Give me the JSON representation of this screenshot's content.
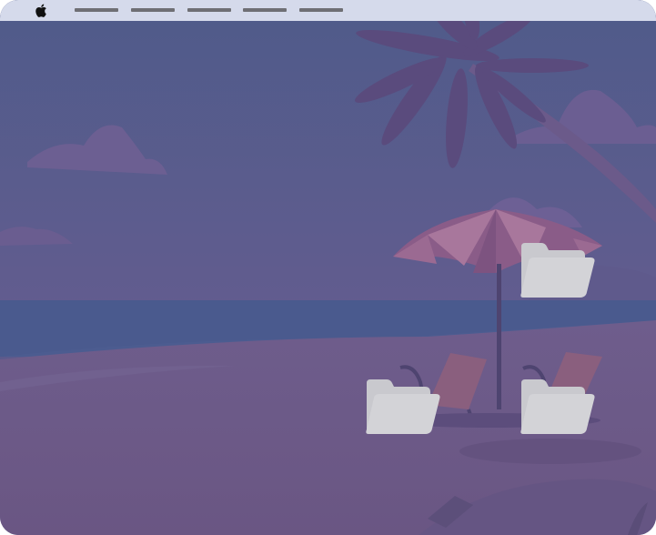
{
  "menubar": {
    "menu_items": [
      {
        "label": ""
      },
      {
        "label": ""
      },
      {
        "label": ""
      },
      {
        "label": ""
      },
      {
        "label": ""
      }
    ],
    "apple_icon": "apple-logo-icon"
  },
  "desktop": {
    "wallpaper": "beach-sunset-illustration",
    "folders": [
      {
        "label": "",
        "icon": "folder-icon"
      },
      {
        "label": "",
        "icon": "folder-icon"
      },
      {
        "label": "",
        "icon": "folder-icon"
      }
    ]
  },
  "colors": {
    "menubar_bg": "#d5daeb",
    "menu_placeholder": "#6f6f74",
    "sky": "#5b5a8c",
    "sea": "#4a5a8e",
    "sand": "#6a5a87",
    "folder_fill": "#cfcfd3"
  }
}
